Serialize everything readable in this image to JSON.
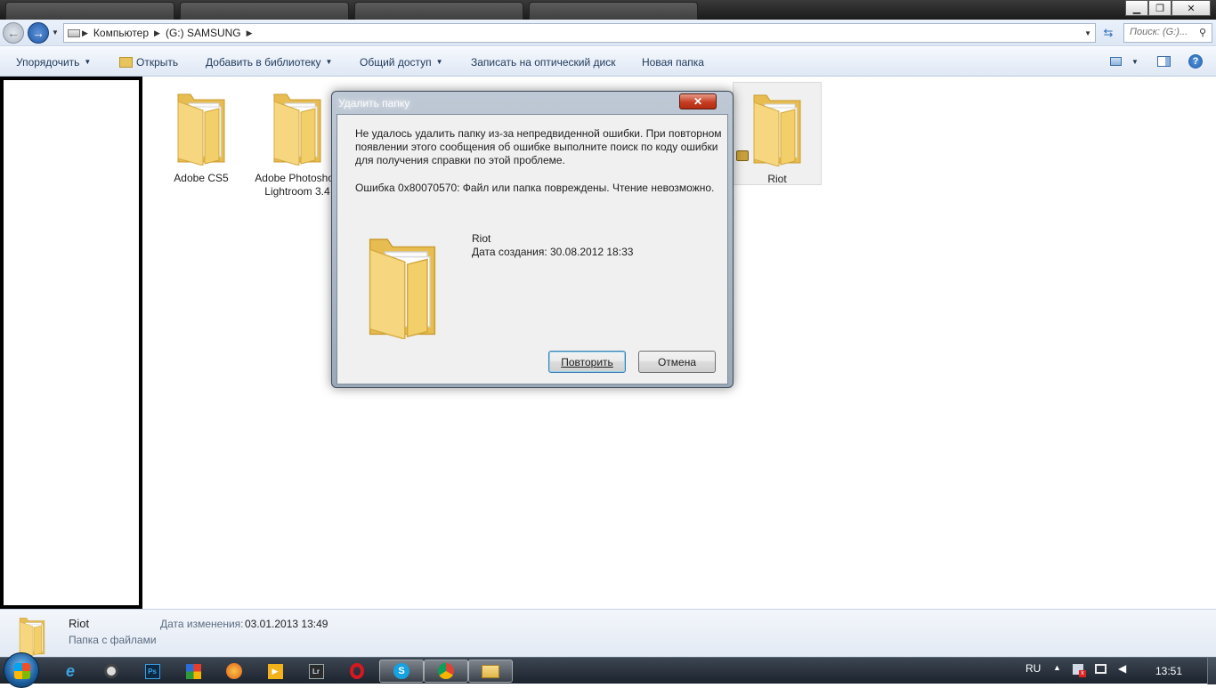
{
  "address": {
    "crumbs": [
      "Компьютер",
      "(G:) SAMSUNG"
    ],
    "search_placeholder": "Поиск: (G:)..."
  },
  "toolbar": {
    "organize": "Упорядочить",
    "open": "Открыть",
    "add_to_library": "Добавить в библиотеку",
    "share": "Общий доступ",
    "burn": "Записать на оптический диск",
    "new_folder": "Новая папка"
  },
  "folders": [
    {
      "label": "Adobe CS5"
    },
    {
      "label": "Adobe Photoshop Lightroom 3.4"
    },
    {
      "label": "Riot"
    }
  ],
  "dialog": {
    "title": "Удалить папку",
    "close": "✕",
    "message": "Не удалось удалить папку из-за непредвиденной ошибки. При повторном появлении этого сообщения об ошибке выполните поиск по коду ошибки для получения справки по этой проблеме.",
    "error": "Ошибка 0x80070570: Файл или папка повреждены. Чтение невозможно.",
    "item_name": "Riot",
    "item_date": "Дата создания: 30.08.2012 18:33",
    "retry": "Повторить",
    "cancel": "Отмена"
  },
  "details": {
    "name": "Riot",
    "type": "Папка с файлами",
    "modified_label": "Дата изменения:",
    "modified_value": "03.01.2013 13:49"
  },
  "taskbar": {
    "lang": "RU",
    "time": "13:51",
    "apps": [
      "internet-explorer",
      "steam",
      "photoshop",
      "winamp",
      "firefox",
      "media-player",
      "lightroom",
      "opera",
      "skype",
      "chrome",
      "explorer"
    ]
  },
  "colors": {
    "folder": "#f3d37a",
    "toolbar_text": "#1e395b",
    "dialog_close": "#c53d22"
  }
}
